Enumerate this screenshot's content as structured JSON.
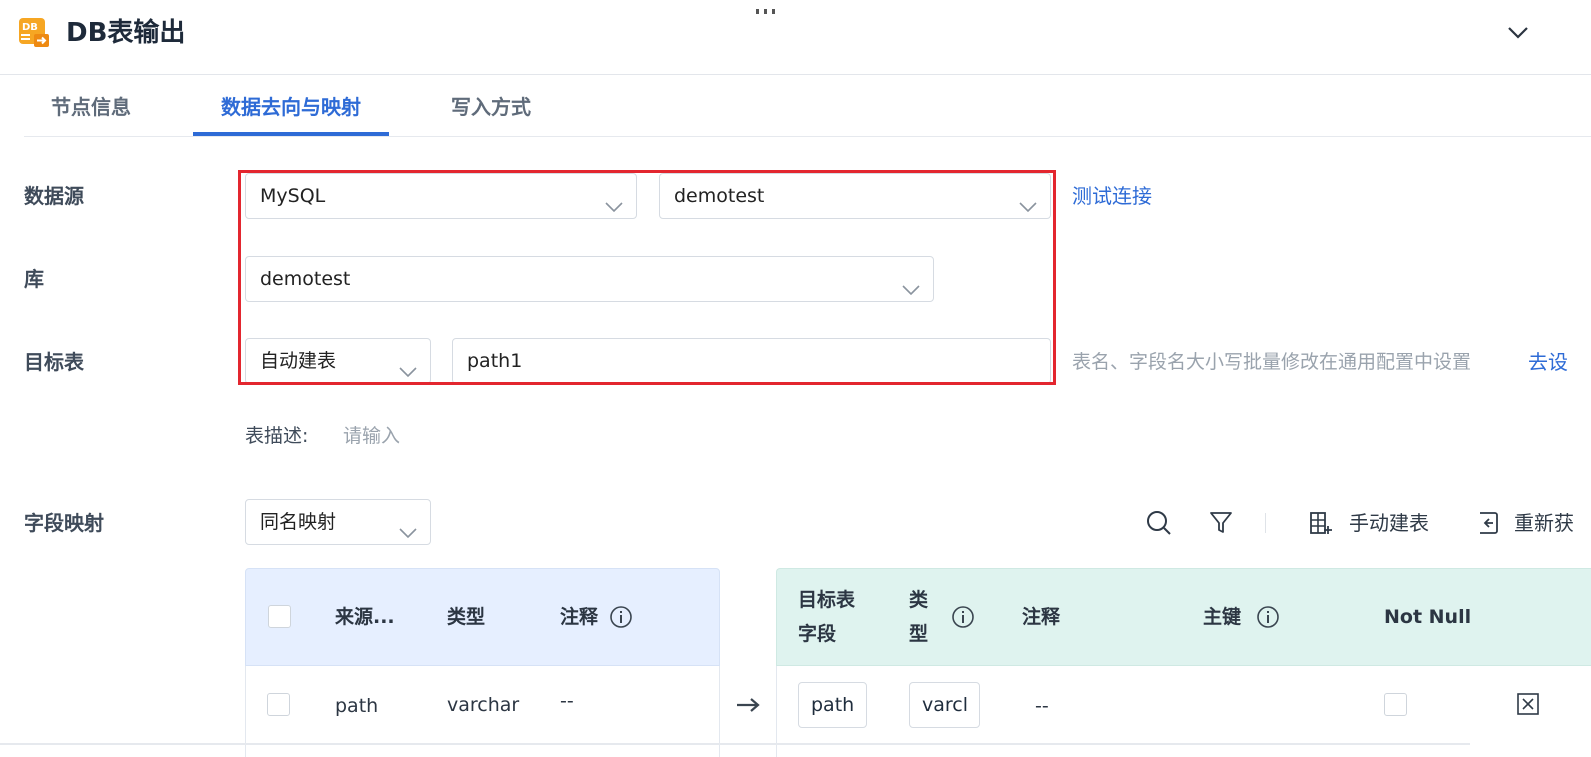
{
  "header": {
    "title": "DB表输出",
    "icon_text": "DB",
    "icon": "db-table-output-icon",
    "collapse_icon": "chevron-down-icon"
  },
  "tabs": [
    {
      "label": "节点信息",
      "active": false
    },
    {
      "label": "数据去向与映射",
      "active": true
    },
    {
      "label": "写入方式",
      "active": false
    }
  ],
  "form": {
    "datasource_label": "数据源",
    "datasource_type": "MySQL",
    "datasource_conn": "demotest",
    "test_connection": "测试连接",
    "database_label": "库",
    "database_value": "demotest",
    "target_label": "目标表",
    "target_mode": "自动建表",
    "target_table": "path1",
    "target_hint": "表名、字段名大小写批量修改在通用配置中设置",
    "target_link": "去设",
    "desc_label": "表描述:",
    "desc_placeholder": "请输入",
    "mapping_label": "字段映射",
    "mapping_mode": "同名映射"
  },
  "toolbar": {
    "search_icon": "search-icon",
    "filter_icon": "filter-icon",
    "manual_create": "手动建表",
    "refresh": "重新获"
  },
  "source_table": {
    "headers": {
      "field": "来源...",
      "type": "类型",
      "comment": "注释"
    },
    "rows": [
      {
        "field": "path",
        "type": "varchar",
        "comment": "--"
      }
    ]
  },
  "target_table": {
    "headers": {
      "field_line1": "目标表",
      "field_line2": "字段",
      "type_line1": "类",
      "type_line2": "型",
      "comment": "注释",
      "primary_key": "主键",
      "not_null": "Not Null"
    },
    "rows": [
      {
        "field": "path",
        "type": "varcl",
        "comment": "--"
      }
    ]
  },
  "colors": {
    "accent": "#2e6bd6",
    "highlight": "#e3262f",
    "source_header_bg": "#e6efff",
    "target_header_bg": "#dff3ef"
  }
}
